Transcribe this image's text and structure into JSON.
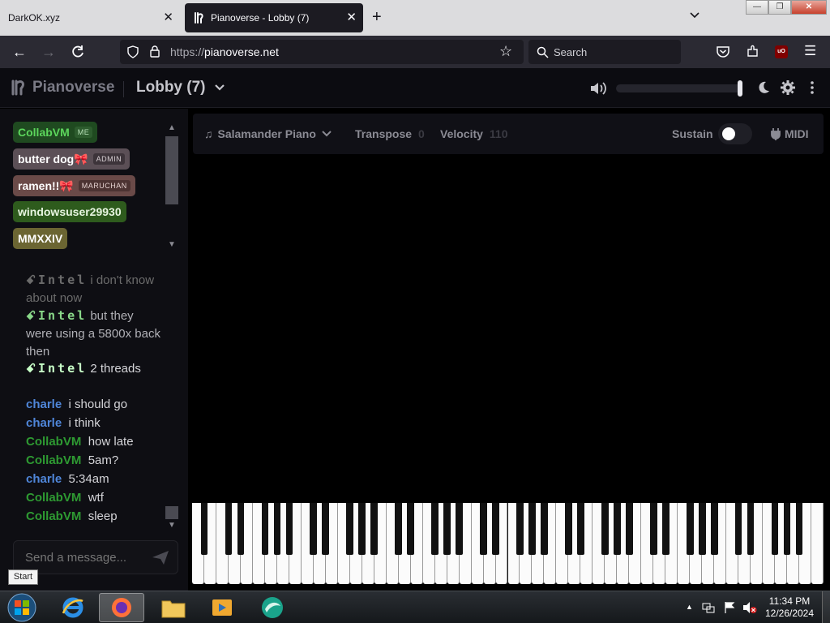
{
  "browser": {
    "tabs": [
      {
        "title": "DarkOK.xyz"
      },
      {
        "title": "Pianoverse - Lobby (7)"
      }
    ],
    "url_scheme": "https://",
    "url_host": "pianoverse.net",
    "search_placeholder": "Search"
  },
  "header": {
    "logo_text": "Pianoverse",
    "room_name": "Lobby (7)",
    "volume_level": 1.0
  },
  "users": [
    {
      "name": "CollabVM",
      "tag": "ME",
      "bg": "#1f4a20",
      "color": "#5cd65c",
      "tag_bg": "#2d5c2e",
      "tag_color": "#b7e0b7"
    },
    {
      "name": "butter dog🎀",
      "tag": "ADMIN",
      "bg": "#5b4f56",
      "color": "#ffffff",
      "tag_bg": "#3d343a",
      "tag_color": "#d8d0d4"
    },
    {
      "name": "ramen!!🎀",
      "tag": "MARUCHAN",
      "bg": "#6a4a48",
      "color": "#ffffff",
      "tag_bg": "#4c3332",
      "tag_color": "#e5d2d0"
    },
    {
      "name": "windowsuser29930",
      "tag": "",
      "bg": "#2e5b1d",
      "color": "#e7f5e0"
    },
    {
      "name": "MMXXIV",
      "tag": "",
      "bg": "#6b6532",
      "color": "#ffffff"
    }
  ],
  "chat": [
    {
      "nick": "ꗃIntel",
      "nick_style": "intel-dim",
      "text": "i don't know about now"
    },
    {
      "nick": "ꗃIntel",
      "nick_style": "intel",
      "text": "but they were using a 5800x back then"
    },
    {
      "nick": "ꗃIntel",
      "nick_style": "intel-bright",
      "text": "2 threads"
    },
    {
      "nick": "charle",
      "nick_style": "blue",
      "text": "i should go"
    },
    {
      "nick": "charle",
      "nick_style": "blue",
      "text": "i think"
    },
    {
      "nick": "CollabVM",
      "nick_style": "green",
      "text": "how late"
    },
    {
      "nick": "CollabVM",
      "nick_style": "green",
      "text": "5am?"
    },
    {
      "nick": "charle",
      "nick_style": "blue",
      "text": "5:34am"
    },
    {
      "nick": "CollabVM",
      "nick_style": "green",
      "text": "wtf"
    },
    {
      "nick": "CollabVM",
      "nick_style": "green",
      "text": "sleep"
    }
  ],
  "message_placeholder": "Send a message...",
  "toolbar": {
    "instrument": "Salamander Piano",
    "transpose_label": "Transpose",
    "transpose_value": "0",
    "velocity_label": "Velocity",
    "velocity_value": "110",
    "sustain_label": "Sustain",
    "sustain_on": false,
    "midi_label": "MIDI"
  },
  "keyboard": {
    "white_keys": 52
  },
  "taskbar": {
    "start_tooltip": "Start",
    "time": "11:34 PM",
    "date": "12/26/2024"
  }
}
